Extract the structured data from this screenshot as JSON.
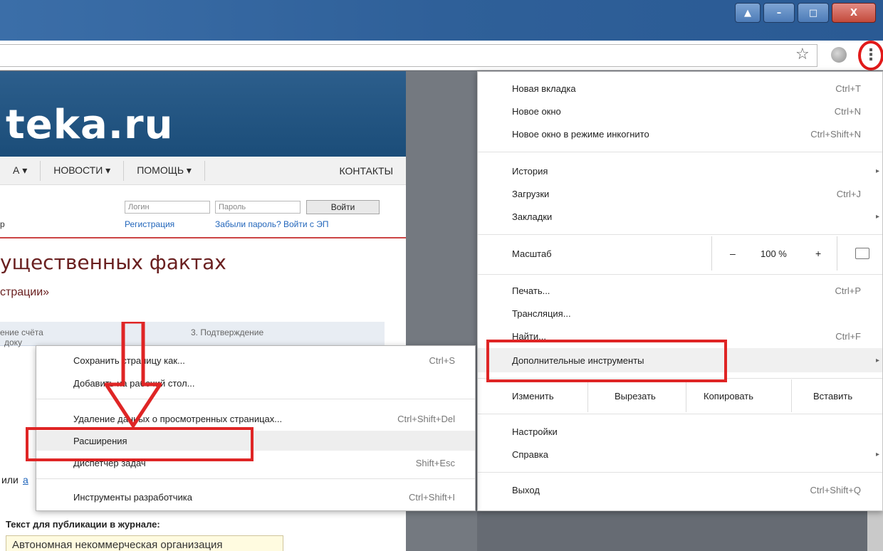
{
  "window": {
    "controls": {
      "user": "▲",
      "minimize": "–",
      "maximize": "□",
      "close": "X"
    }
  },
  "toolbar": {
    "bookmark_icon": "star-icon",
    "menu_icon": "three-dot-menu-icon"
  },
  "page": {
    "logo": "teka.ru",
    "nav": [
      "А ▾",
      "НОВОСТИ ▾",
      "ПОМОЩЬ ▾",
      "КОНТАКТЫ"
    ],
    "login_placeholder": "Логин",
    "password_placeholder": "Пароль",
    "login_button": "Войти",
    "left_fragment": "р",
    "register_link": "Регистрация",
    "forgot_link": "Забыли пароль? Войти с ЭП",
    "heading": "ущественных фактах",
    "subheading": "страции»",
    "tab_left_top": "ение счёта",
    "tab_left_bottom": "доку",
    "tab_right": "3. Подтверждение",
    "left_text_fragment": "или",
    "left_link_fragment": "а",
    "journal_label": "Текст для публикации в журнале:",
    "journal_text": "Автономная некоммерческая организация"
  },
  "menu": {
    "items": [
      {
        "label": "Новая вкладка",
        "shortcut": "Ctrl+T"
      },
      {
        "label": "Новое окно",
        "shortcut": "Ctrl+N"
      },
      {
        "label": "Новое окно в режиме инкогнито",
        "shortcut": "Ctrl+Shift+N"
      },
      {
        "label": "История",
        "arrow": "▸"
      },
      {
        "label": "Загрузки",
        "shortcut": "Ctrl+J"
      },
      {
        "label": "Закладки",
        "arrow": "▸"
      },
      {
        "label": "Масштаб"
      },
      {
        "label": "Печать...",
        "shortcut": "Ctrl+P"
      },
      {
        "label": "Трансляция..."
      },
      {
        "label": "Найти...",
        "shortcut": "Ctrl+F"
      },
      {
        "label": "Дополнительные инструменты",
        "arrow": "▸"
      },
      {
        "label": "Изменить"
      },
      {
        "label": "Вырезать"
      },
      {
        "label": "Копировать"
      },
      {
        "label": "Вставить"
      },
      {
        "label": "Настройки"
      },
      {
        "label": "Справка",
        "arrow": "▸"
      },
      {
        "label": "Выход",
        "shortcut": "Ctrl+Shift+Q"
      }
    ],
    "zoom": {
      "minus": "–",
      "level": "100 %",
      "plus": "+"
    }
  },
  "submenu": {
    "items": [
      {
        "label": "Сохранить страницу как...",
        "shortcut": "Ctrl+S"
      },
      {
        "label": "Добавить на рабочий стол..."
      },
      {
        "label": "Удаление данных о просмотренных страницах...",
        "shortcut": "Ctrl+Shift+Del"
      },
      {
        "label": "Расширения"
      },
      {
        "label": "Диспетчер задач",
        "shortcut": "Shift+Esc"
      },
      {
        "label": "Инструменты разработчика",
        "shortcut": "Ctrl+Shift+I"
      }
    ]
  },
  "colors": {
    "annotation_red": "#df2525",
    "titlebar": "#2f6099",
    "site_header": "#1b4d79"
  }
}
